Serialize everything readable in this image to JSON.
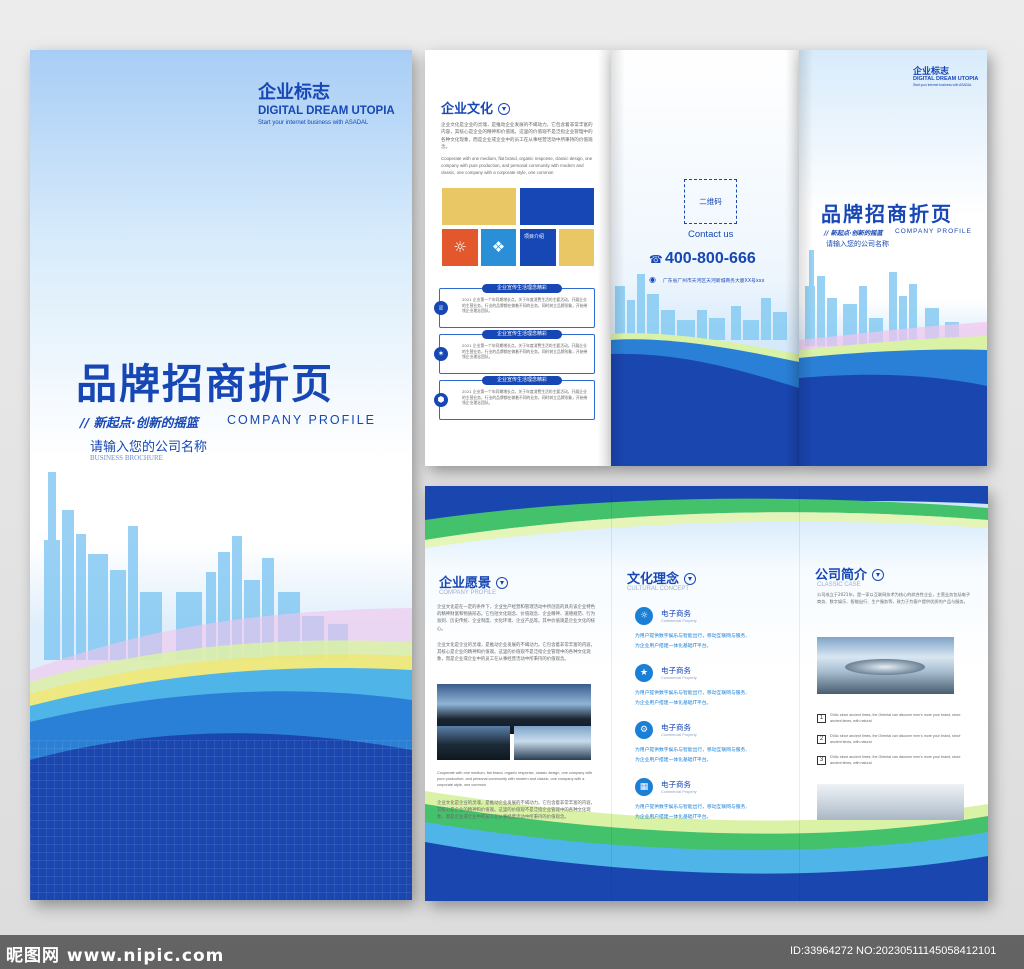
{
  "cover": {
    "logo_cn": "企业标志",
    "logo_en": "DIGITAL DREAM UTOPIA",
    "logo_sub": "Start your internet business with ASADAL",
    "title": "品牌招商折页",
    "slogan": "// 新起点·创新的摇篮",
    "profile": "COMPANY PROFILE",
    "company_name": "请输入您的公司名称",
    "company_name_en": "BUSINESS BROCHURE"
  },
  "culture": {
    "title": "企业文化",
    "para1": "企业文化是企业的灵魂，是推动企业发展的不竭动力。它包含着非常丰富的内容，其核心是企业的精神和价值观。这里的价值观不是泛指企业管理中的各种文化现象，而是企业或企业中的员工在从事经营活动中所秉持的价值观念。",
    "para2": "Cooperate with one medium, flat brand, organic response, classic design, one company with pure production, and personal community with modern and classic, one company with a corporate style, one common",
    "tile_text": "项目介绍",
    "timeline": [
      {
        "tag": "企业宣传生活理念精彩",
        "text": "2021 企业第一个年同期增长点，关于年度消费生活的主要活动，开展企业的主营业务，行业的品牌都在做着不同的业务，同时树立品牌形象，开始带领企业理念团队。"
      },
      {
        "tag": "企业宣传生活理念精彩",
        "text": "2021 企业第一个年同期增长点，关于年度消费生活的主要活动，开展企业的主营业务，行业的品牌都在做着不同的业务，同时树立品牌形象，开始带领企业理念团队。"
      },
      {
        "tag": "企业宣传生活理念精彩",
        "text": "2021 企业第一个年同期增长点，关于年度消费生活的主要活动，开展企业的主营业务，行业的品牌都在做着不同的业务，同时树立品牌形象，开始带领企业理念团队。"
      }
    ]
  },
  "contact": {
    "qr_label": "二维码",
    "contact_label": "Contact us",
    "phone": "400-800-666",
    "address": "广东省广州市天河区天河新城商务大厦XX号xxx"
  },
  "back": {
    "logo_cn": "企业标志",
    "logo_en": "DIGITAL DREAM UTOPIA",
    "logo_sub": "Start your internet business with ASADAL",
    "title": "品牌招商折页",
    "slogan": "// 新起点·创新的摇篮",
    "profile": "COMPANY PROFILE",
    "company_name": "请输入您的公司名称"
  },
  "vision": {
    "title": "企业愿景",
    "subtitle": "COMPANY PROFILE",
    "para1": "企业文化是在一定的条件下，企业生产经营和管理活动中所创造的具有该企业特色的精神财富和物质形态。它包括文化观念、价值观念、企业精神、道德规范、行为准则、历史传统、企业制度、文化环境、企业产品等。其中价值观是企业文化的核心。",
    "para2": "企业文化是企业的灵魂，是推动企业发展的不竭动力。它包含着非常丰富的内容，其核心是企业的精神和价值观。这里的价值观不是泛指企业管理中的各种文化现象，而是企业或企业中的员工在从事经营活动中所秉持的价值观念。",
    "para3": "Cooperate with one medium, flat brand, organic response, classic design, one company with pure production, and personal community with modern and classic, one company with a corporate style, one common",
    "para4": "企业文化是企业的灵魂，是推动企业发展的不竭动力。它包含着非常丰富的内容，其核心是企业的精神和价值观。这里的价值观不是泛指企业管理中的各种文化现象，而是企业或企业中的员工在从事经营活动中所秉持的价值观念。"
  },
  "concept": {
    "title": "文化理念",
    "subtitle": "CULTURAL CONCEPT",
    "items": [
      {
        "title": "电子商务",
        "en": "Commercial Property",
        "line1": "为用户提供数字娱乐与智能出行，移动互联网与服务,",
        "line2": "为企业用户搭建一体化基础IT平台。"
      },
      {
        "title": "电子商务",
        "en": "Commercial Property",
        "line1": "为用户提供数字娱乐与智能出行，移动互联网与服务,",
        "line2": "为企业用户搭建一体化基础IT平台。"
      },
      {
        "title": "电子商务",
        "en": "Commercial Property",
        "line1": "为用户提供数字娱乐与智能出行，移动互联网与服务,",
        "line2": "为企业用户搭建一体化基础IT平台。"
      },
      {
        "title": "电子商务",
        "en": "Commercial Property",
        "line1": "为用户提供数字娱乐与智能出行，移动互联网与服务,",
        "line2": "为企业用户搭建一体化基础IT平台。"
      }
    ]
  },
  "intro": {
    "title": "公司简介",
    "subtitle": "CLASSIC CASE",
    "para": "公司成立于2021年，是一家以互联网技术为核心的综合性企业，主营业务包括电子商务、数字娱乐、智能出行、生产服务等，致力于为客户提供优质的产品与服务。",
    "list": [
      {
        "num": "1",
        "text": "DVAc since ancient times, the Oriental can discover men's more your brand, since ancient times, with natural"
      },
      {
        "num": "2",
        "text": "DVAc since ancient times, the Oriental can discover men's more your brand, since ancient times, with natural"
      },
      {
        "num": "3",
        "text": "DVAc since ancient times, the Oriental can discover men's more your brand, since ancient times, with natural"
      }
    ]
  },
  "watermark": {
    "left": "昵图网 www.nipic.com",
    "right": "ID:33964272 NO:20230511145058412101"
  },
  "colors": {
    "brand_blue": "#1747b5",
    "deep_blue": "#1a3fa8",
    "sky_blue": "#7cc4f2",
    "green": "#43c26b",
    "yellow": "#e8c764",
    "orange": "#e2572b"
  }
}
